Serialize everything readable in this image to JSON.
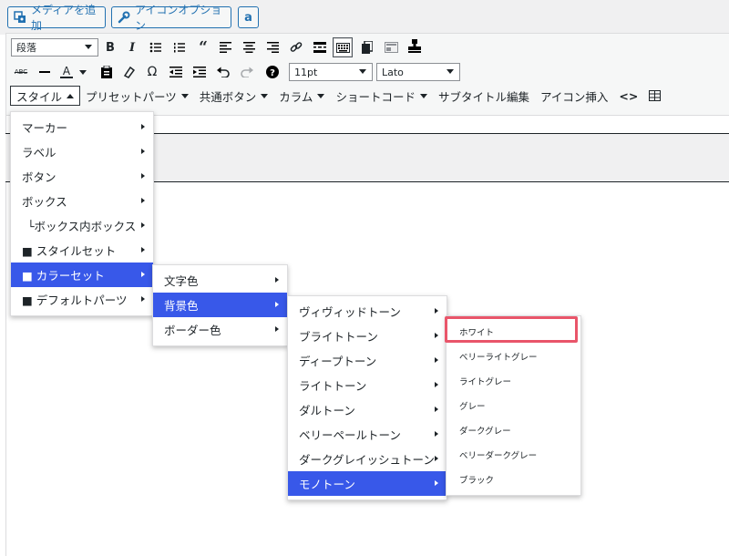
{
  "topbar": {
    "add_media": "メディアを追加",
    "icon_option": "アイコンオプション",
    "amazon": "a"
  },
  "toolbar": {
    "format_select": "段落",
    "font_size": "11pt",
    "font_family": "Lato",
    "row3": [
      {
        "label": "スタイル",
        "active": true
      },
      {
        "label": "プリセットパーツ"
      },
      {
        "label": "共通ボタン"
      },
      {
        "label": "カラム"
      },
      {
        "label": "ショートコード"
      },
      {
        "label": "サブタイトル編集"
      },
      {
        "label": "アイコン挿入"
      }
    ],
    "code_icon": "<>",
    "abc": "ABC",
    "text_color_letter": "A"
  },
  "menus": {
    "style": [
      "マーカー",
      "ラベル",
      "ボタン",
      "ボックス",
      "└ボックス内ボックス",
      "■ スタイルセット",
      "■ カラーセット",
      "■ デフォルトパーツ"
    ],
    "colorset": [
      "文字色",
      "背景色",
      "ボーダー色"
    ],
    "tones": [
      "ヴィヴィッドトーン",
      "ブライトトーン",
      "ディープトーン",
      "ライトトーン",
      "ダルトーン",
      "ベリーペールトーン",
      "ダークグレイッシュトーン",
      "モノトーン"
    ],
    "mono": [
      "ホワイト",
      "ベリーライトグレー",
      "ライトグレー",
      "グレー",
      "ダークグレー",
      "ベリーダークグレー",
      "ブラック"
    ]
  },
  "colors": {
    "selected_bg": "#3858e9",
    "highlight": "#e9556a",
    "link": "#2271b1"
  }
}
